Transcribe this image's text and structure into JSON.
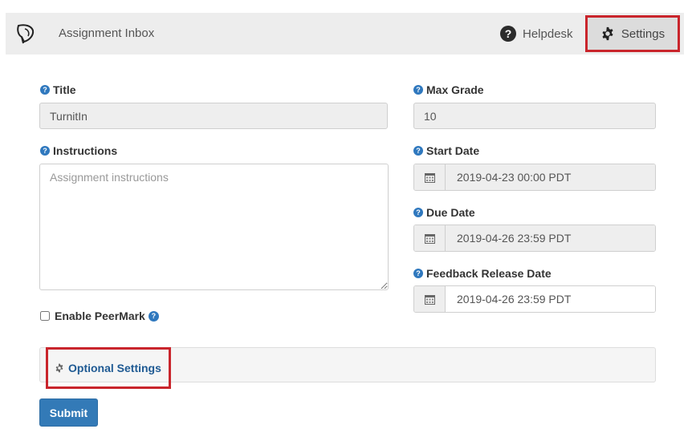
{
  "header": {
    "app_title": "Assignment Inbox",
    "helpdesk_label": "Helpdesk",
    "settings_label": "Settings"
  },
  "form": {
    "title": {
      "label": "Title",
      "value": "TurnitIn"
    },
    "instructions": {
      "label": "Instructions",
      "placeholder": "Assignment instructions"
    },
    "max_grade": {
      "label": "Max Grade",
      "value": "10"
    },
    "start_date": {
      "label": "Start Date",
      "value": "2019-04-23 00:00 PDT"
    },
    "due_date": {
      "label": "Due Date",
      "value": "2019-04-26 23:59 PDT"
    },
    "feedback_release_date": {
      "label": "Feedback Release Date",
      "value": "2019-04-26 23:59 PDT"
    },
    "peermark": {
      "label": "Enable PeerMark",
      "checked": false
    },
    "optional_settings_label": "Optional Settings",
    "submit_label": "Submit"
  },
  "icons": {
    "help": "question-circle-icon",
    "calendar": "calendar-icon",
    "gear": "gear-icon"
  },
  "colors": {
    "highlight_border": "#c9252c",
    "link": "#1f5a93",
    "primary_button": "#337ab7",
    "help_icon": "#2f78be"
  }
}
